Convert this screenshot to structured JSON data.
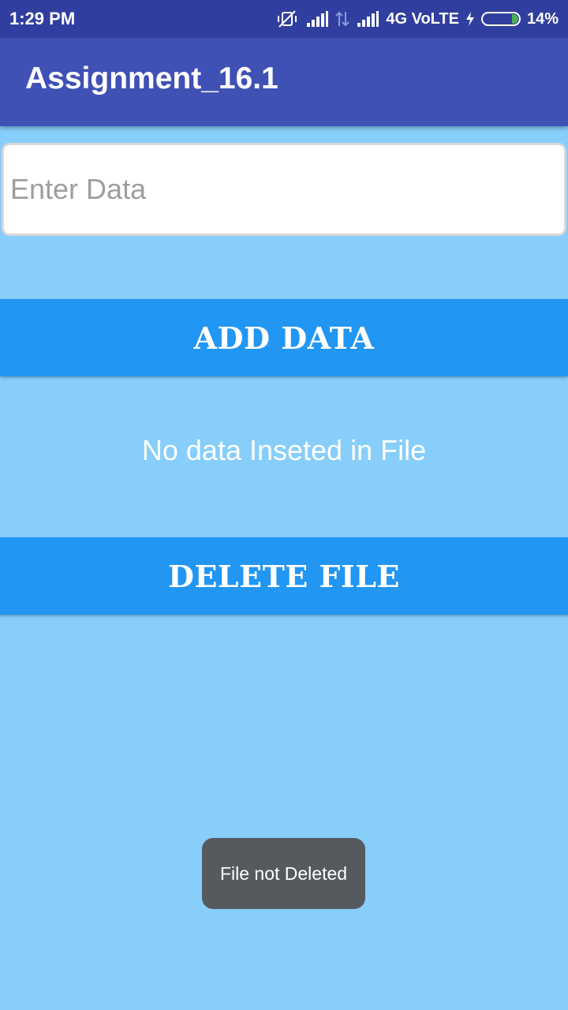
{
  "status_bar": {
    "time": "1:29 PM",
    "network": "4G VoLTE",
    "battery": "14%",
    "icons": [
      "vibrate-off-icon",
      "signal-icon",
      "data-arrows-icon",
      "signal-icon",
      "charging-icon",
      "battery-icon"
    ]
  },
  "app_bar": {
    "title": "Assignment_16.1",
    "color": "#3f51b5"
  },
  "input": {
    "value": "",
    "placeholder": "Enter Data"
  },
  "buttons": {
    "add_label": "ADD DATA",
    "delete_label": "DELETE FILE",
    "color": "#2196f3"
  },
  "message": "No data Inseted in File",
  "toast": "File not Deleted",
  "colors": {
    "background": "#87cefa",
    "status_bar": "#303f9f"
  }
}
